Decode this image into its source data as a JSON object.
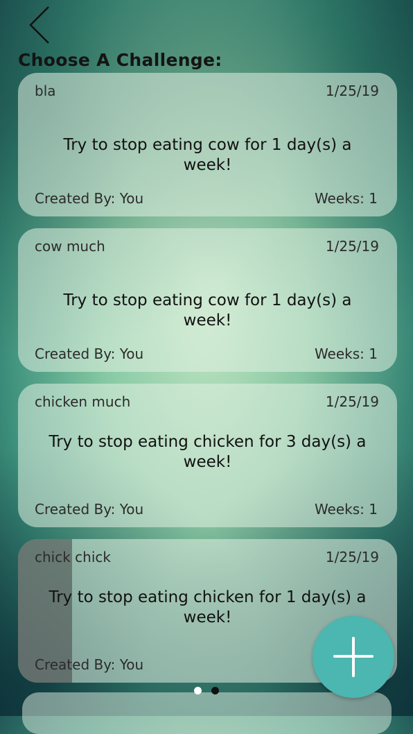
{
  "page": {
    "title": "Choose A Challenge:",
    "colors": {
      "fab": "#4cb6b0",
      "pager_inactive": "#ffffff",
      "pager_active": "#111111"
    }
  },
  "nav": {
    "back_icon": "chevron-left-icon"
  },
  "challenges": [
    {
      "name": "bla",
      "date": "1/25/19",
      "description": "Try to stop eating cow for 1 day(s) a week!",
      "created_by": "Created By: You",
      "weeks": "Weeks: 1"
    },
    {
      "name": "cow much",
      "date": "1/25/19",
      "description": "Try to stop eating cow for 1 day(s) a week!",
      "created_by": "Created By: You",
      "weeks": "Weeks: 1"
    },
    {
      "name": "chicken much",
      "date": "1/25/19",
      "description": "Try to stop eating chicken for 3 day(s) a week!",
      "created_by": "Created By: You",
      "weeks": "Weeks: 1"
    },
    {
      "name": "chick chick",
      "date": "1/25/19",
      "description": "Try to stop eating chicken for 1 day(s) a week!",
      "created_by": "Created By: You",
      "weeks": ""
    }
  ],
  "pager": {
    "current": 2,
    "total": 2
  },
  "fab": {
    "icon": "plus-icon"
  }
}
